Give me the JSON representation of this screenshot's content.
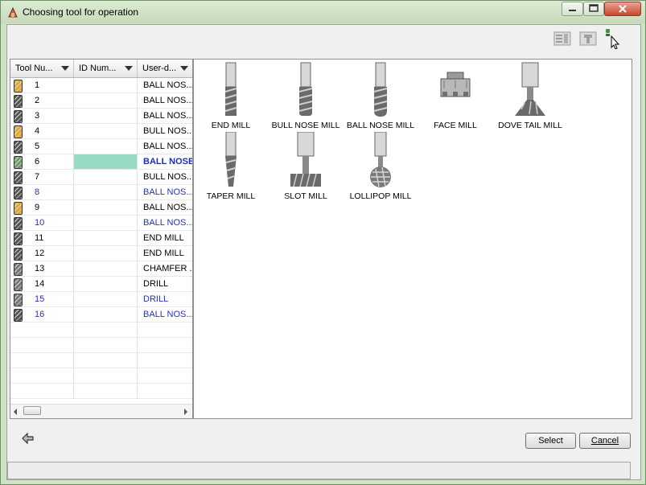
{
  "window": {
    "title": "Choosing tool for operation"
  },
  "toolbar": {
    "icons": [
      "table-view-icon",
      "tool-view-icon",
      "hover-select-icon"
    ]
  },
  "tool_list": {
    "columns": [
      "Tool Nu...",
      "ID Num...",
      "User-d..."
    ],
    "rows": [
      {
        "num": "1",
        "name": "BALL NOS...",
        "icon_color": "#e0a832",
        "blue": false,
        "selected": false
      },
      {
        "num": "2",
        "name": "BALL NOS...",
        "icon_color": "#555555",
        "blue": false,
        "selected": false
      },
      {
        "num": "3",
        "name": "BALL NOS...",
        "icon_color": "#555555",
        "blue": false,
        "selected": false
      },
      {
        "num": "4",
        "name": "BULL NOS...",
        "icon_color": "#e0a832",
        "blue": false,
        "selected": false
      },
      {
        "num": "5",
        "name": "BALL NOS...",
        "icon_color": "#555555",
        "blue": false,
        "selected": false
      },
      {
        "num": "6",
        "name": "BALL NOSE",
        "icon_color": "#6f9a6a",
        "blue": false,
        "selected": true
      },
      {
        "num": "7",
        "name": "BULL NOS...",
        "icon_color": "#555555",
        "blue": false,
        "selected": false
      },
      {
        "num": "8",
        "name": "BALL NOS...",
        "icon_color": "#555555",
        "blue": true,
        "selected": false
      },
      {
        "num": "9",
        "name": "BALL NOS...",
        "icon_color": "#e0a832",
        "blue": false,
        "selected": false
      },
      {
        "num": "10",
        "name": "BALL NOS...",
        "icon_color": "#555555",
        "blue": true,
        "selected": false
      },
      {
        "num": "11",
        "name": "END MILL",
        "icon_color": "#555555",
        "blue": false,
        "selected": false
      },
      {
        "num": "12",
        "name": "END MILL",
        "icon_color": "#555555",
        "blue": false,
        "selected": false
      },
      {
        "num": "13",
        "name": "CHAMFER ...",
        "icon_color": "#777777",
        "blue": false,
        "selected": false
      },
      {
        "num": "14",
        "name": "DRILL",
        "icon_color": "#777777",
        "blue": false,
        "selected": false
      },
      {
        "num": "15",
        "name": "DRILL",
        "icon_color": "#777777",
        "blue": true,
        "selected": false
      },
      {
        "num": "16",
        "name": "BALL NOS...",
        "icon_color": "#555555",
        "blue": true,
        "selected": false
      }
    ]
  },
  "tool_types": [
    {
      "label": "END MILL",
      "icon": "end-mill-icon"
    },
    {
      "label": "BULL NOSE MILL",
      "icon": "bull-nose-mill-icon"
    },
    {
      "label": "BALL NOSE MILL",
      "icon": "ball-nose-mill-icon"
    },
    {
      "label": "FACE MILL",
      "icon": "face-mill-icon"
    },
    {
      "label": "DOVE TAIL MILL",
      "icon": "dove-tail-mill-icon"
    },
    {
      "label": "TAPER MILL",
      "icon": "taper-mill-icon"
    },
    {
      "label": "SLOT MILL",
      "icon": "slot-mill-icon"
    },
    {
      "label": "LOLLIPOP MILL",
      "icon": "lollipop-mill-icon"
    }
  ],
  "buttons": {
    "select": "Select",
    "cancel": "Cancel"
  },
  "status": {
    "text": ""
  }
}
